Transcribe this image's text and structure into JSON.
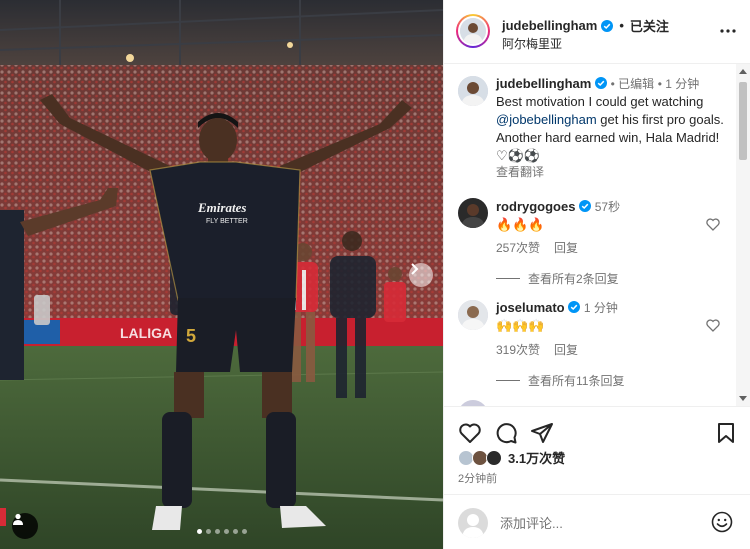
{
  "post": {
    "username": "judebellingham",
    "follow_separator": "•",
    "follow_label": "已关注",
    "location": "阿尔梅里亚",
    "more_icon": "more-horizontal-icon"
  },
  "caption": {
    "username": "judebellingham",
    "edited_label": "• 已编辑",
    "time": "• 1 分钟",
    "text_before": "Best motivation I could get watching ",
    "mention": "@jobebellingham",
    "text_after": " get his first pro goals. Another hard earned win, Hala Madrid!♡⚽⚽",
    "translate_label": "查看翻译"
  },
  "comments": [
    {
      "username": "rodrygogoes",
      "time": "57秒",
      "text": "🔥🔥🔥",
      "likes": "257次赞",
      "reply_label": "回复",
      "view_replies": "查看所有2条回复"
    },
    {
      "username": "joselumato",
      "time": "1 分钟",
      "text": "🙌🙌🙌",
      "likes": "319次赞",
      "reply_label": "回复",
      "view_replies": "查看所有11条回复"
    }
  ],
  "actions": {
    "like_icon": "heart-icon",
    "comment_icon": "comment-icon",
    "share_icon": "send-icon",
    "save_icon": "bookmark-icon"
  },
  "likes_summary": "3.1万次赞",
  "posted_time": "2分钟前",
  "add_comment": {
    "placeholder": "添加评论...",
    "emoji_icon": "smiley-icon"
  },
  "photo": {
    "shirt_sponsor_line1": "Emirates",
    "shirt_sponsor_line2": "FLY BETTER",
    "shirt_number": "5",
    "slide_count": 6,
    "active_slide": 1
  },
  "colors": {
    "verified": "#0095f6",
    "text": "#262626",
    "muted": "#737373",
    "mention": "#00376b"
  }
}
